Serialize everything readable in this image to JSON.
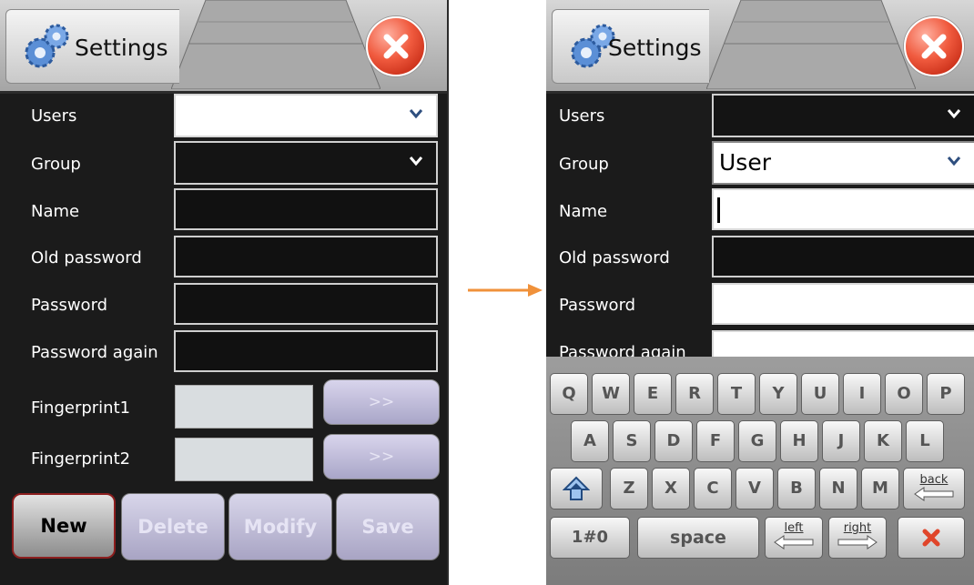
{
  "colors": {
    "screen_bg": "#1b1b1b",
    "arrow": "#f0913a",
    "close_red": "#e0452a"
  },
  "left": {
    "title": "Settings",
    "form": {
      "users_label": "Users",
      "group_label": "Group",
      "name_label": "Name",
      "old_password_label": "Old password",
      "password_label": "Password",
      "password_again_label": "Password again",
      "fingerprint1_label": "Fingerprint1",
      "fingerprint2_label": "Fingerprint2",
      "fingerprint1_button": ">>",
      "fingerprint2_button": ">>"
    },
    "buttons": {
      "new": "New",
      "delete": "Delete",
      "modify": "Modify",
      "save": "Save"
    }
  },
  "right": {
    "title": "Settings",
    "form": {
      "users_label": "Users",
      "group_label": "Group",
      "group_value": "User",
      "name_label": "Name",
      "old_password_label": "Old password",
      "password_label": "Password",
      "password_again_label": "Password again"
    },
    "keyboard": {
      "row1": [
        "Q",
        "W",
        "E",
        "R",
        "T",
        "Y",
        "U",
        "I",
        "O",
        "P"
      ],
      "row2": [
        "A",
        "S",
        "D",
        "F",
        "G",
        "H",
        "J",
        "K",
        "L"
      ],
      "row3": [
        "Z",
        "X",
        "C",
        "V",
        "B",
        "N",
        "M"
      ],
      "back": "back",
      "numbers": "1#0",
      "space": "space",
      "left": "left",
      "right": "right"
    }
  }
}
